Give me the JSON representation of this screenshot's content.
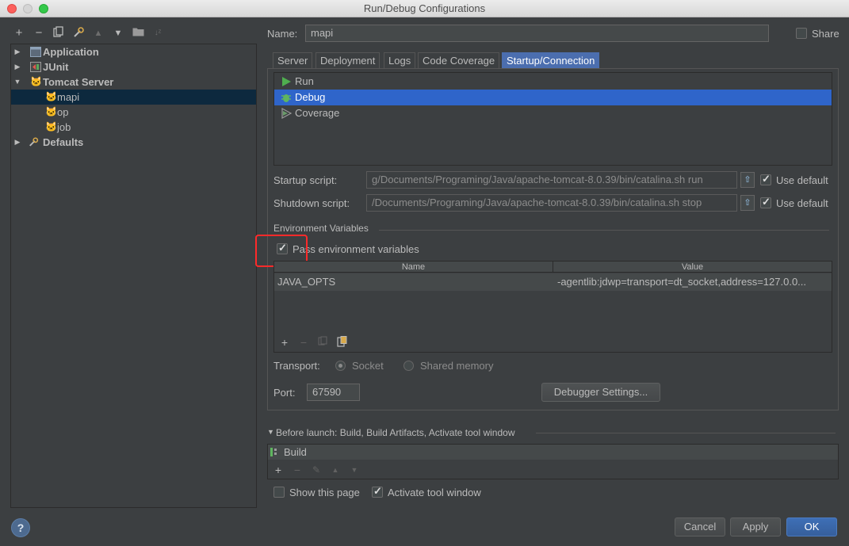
{
  "window": {
    "title": "Run/Debug Configurations"
  },
  "tree": {
    "items": [
      {
        "label": "Application",
        "expanded": false
      },
      {
        "label": "JUnit",
        "expanded": false
      },
      {
        "label": "Tomcat Server",
        "expanded": true
      },
      {
        "label": "mapi",
        "selected": true
      },
      {
        "label": "op"
      },
      {
        "label": "job"
      },
      {
        "label": "Defaults",
        "expanded": false
      }
    ]
  },
  "config": {
    "name_label": "Name:",
    "name_value": "mapi",
    "share_label": "Share",
    "share_checked": false
  },
  "tabs": [
    "Server",
    "Deployment",
    "Logs",
    "Code Coverage",
    "Startup/Connection"
  ],
  "active_tab": "Startup/Connection",
  "modes": [
    {
      "label": "Run"
    },
    {
      "label": "Debug",
      "selected": true
    },
    {
      "label": "Coverage"
    }
  ],
  "startup": {
    "label": "Startup script:",
    "value": "g/Documents/Programing/Java/apache-tomcat-8.0.39/bin/catalina.sh run",
    "use_default_label": "Use default",
    "use_default": true
  },
  "shutdown": {
    "label": "Shutdown script:",
    "value": "/Documents/Programing/Java/apache-tomcat-8.0.39/bin/catalina.sh stop",
    "use_default_label": "Use default",
    "use_default": true
  },
  "env": {
    "section_title": "Environment Variables",
    "pass_label": "Pass environment variables",
    "pass_checked": true,
    "col_name": "Name",
    "col_value": "Value",
    "rows": [
      {
        "name": "JAVA_OPTS",
        "value": "-agentlib:jdwp=transport=dt_socket,address=127.0.0..."
      }
    ]
  },
  "transport": {
    "label": "Transport:",
    "socket_label": "Socket",
    "shared_label": "Shared memory",
    "selected": "Socket"
  },
  "port": {
    "label": "Port:",
    "value": "67590"
  },
  "debugger_settings_label": "Debugger Settings...",
  "before_launch": {
    "title": "Before launch: Build, Build Artifacts, Activate tool window",
    "items": [
      "Build"
    ]
  },
  "show_page": {
    "label": "Show this page",
    "checked": false
  },
  "activate_tool": {
    "label": "Activate tool window",
    "checked": true
  },
  "buttons": {
    "cancel": "Cancel",
    "apply": "Apply",
    "ok": "OK",
    "help": "?"
  }
}
